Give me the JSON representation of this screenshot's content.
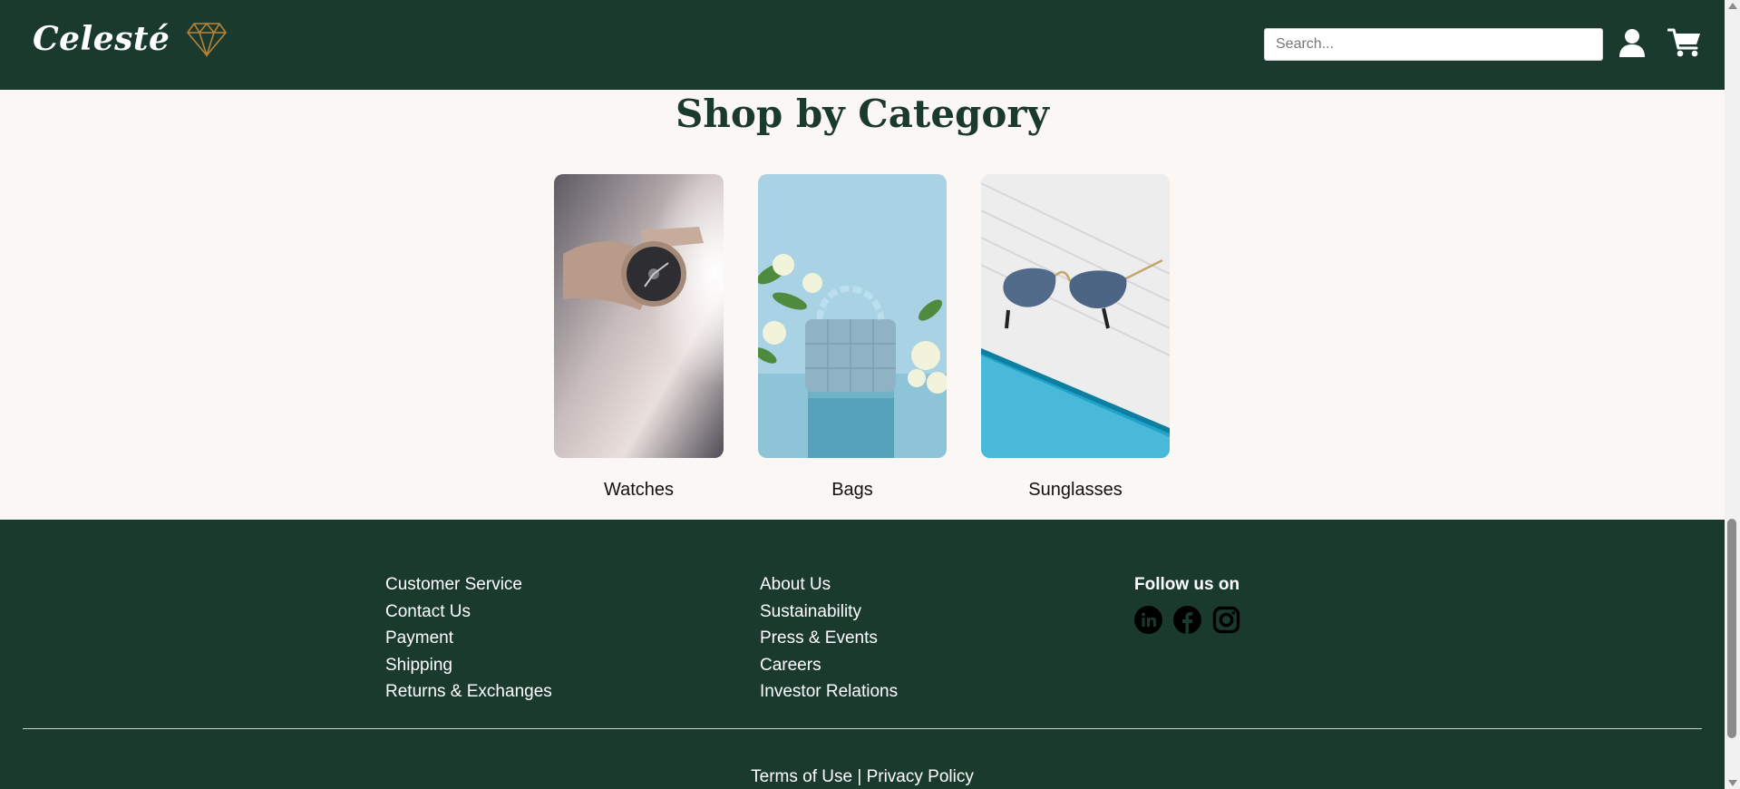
{
  "header": {
    "brand": "Celesté",
    "search_placeholder": "Search..."
  },
  "main": {
    "title": "Shop by Category",
    "categories": [
      {
        "label": "Watches"
      },
      {
        "label": "Bags"
      },
      {
        "label": "Sunglasses"
      }
    ]
  },
  "footer": {
    "col1": [
      "Customer Service",
      "Contact Us",
      "Payment",
      "Shipping",
      "Returns & Exchanges"
    ],
    "col2": [
      "About Us",
      "Sustainability",
      "Press & Events",
      "Careers",
      "Investor Relations"
    ],
    "follow_title": "Follow us on",
    "social_icons": [
      "linkedin-icon",
      "facebook-icon",
      "instagram-icon"
    ],
    "terms": "Terms of Use",
    "separator": "|",
    "privacy": "Privacy Policy"
  },
  "colors": {
    "brand_green": "#1b3a2e",
    "page_bg": "#fbf7f5",
    "gem_gold": "#b8843a"
  }
}
